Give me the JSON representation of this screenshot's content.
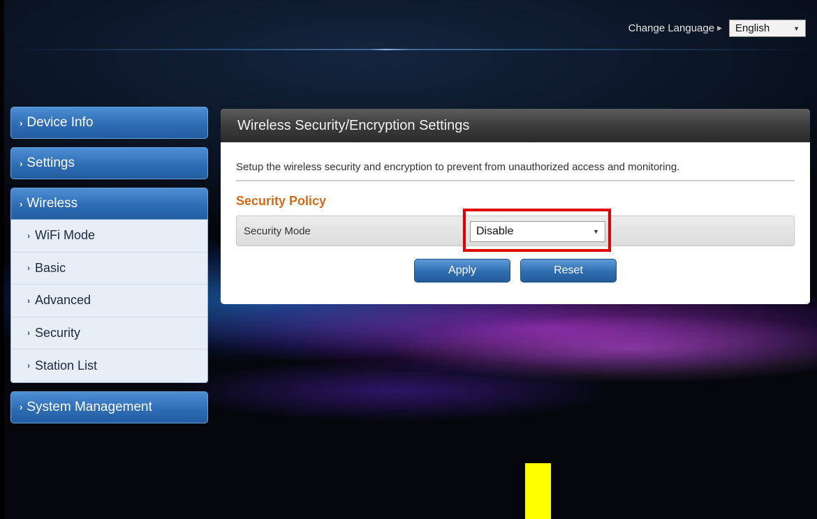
{
  "header": {
    "change_language_label": "Change Language",
    "language_value": "English"
  },
  "sidebar": {
    "items": [
      {
        "label": "Device Info"
      },
      {
        "label": "Settings"
      },
      {
        "label": "Wireless"
      },
      {
        "label": "System Management"
      }
    ],
    "wireless_sub": [
      {
        "label": "WiFi Mode"
      },
      {
        "label": "Basic"
      },
      {
        "label": "Advanced"
      },
      {
        "label": "Security"
      },
      {
        "label": "Station List"
      }
    ]
  },
  "main": {
    "title": "Wireless Security/Encryption Settings",
    "description": "Setup the wireless security and encryption to prevent from unauthorized access and monitoring.",
    "section_title": "Security Policy",
    "security_mode_label": "Security Mode",
    "security_mode_value": "Disable",
    "apply_label": "Apply",
    "reset_label": "Reset"
  },
  "colors": {
    "highlight_box": "#e00000",
    "section_title": "#d26a19",
    "nav_blue": "#2d6db5",
    "marker": "#ffff00"
  }
}
